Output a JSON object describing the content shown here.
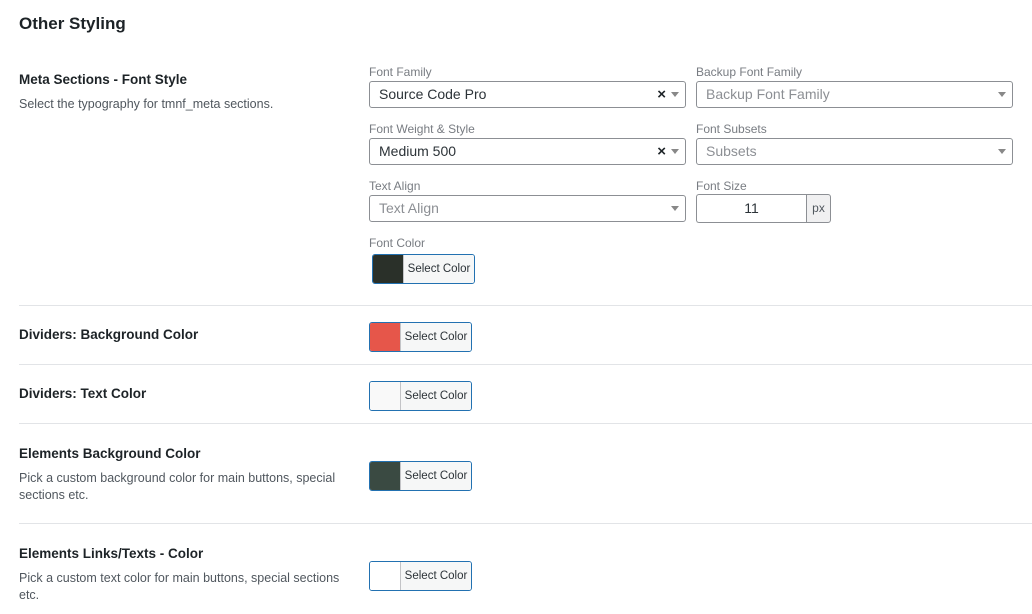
{
  "page": {
    "title": "Other Styling"
  },
  "meta_font": {
    "title": "Meta Sections - Font Style",
    "description": "Select the typography for tmnf_meta sections.",
    "font_family": {
      "label": "Font Family",
      "value": "Source Code Pro"
    },
    "backup_font_family": {
      "label": "Backup Font Family",
      "placeholder": "Backup Font Family"
    },
    "font_weight": {
      "label": "Font Weight & Style",
      "value": "Medium 500"
    },
    "font_subsets": {
      "label": "Font Subsets",
      "placeholder": "Subsets"
    },
    "text_align": {
      "label": "Text Align",
      "placeholder": "Text Align"
    },
    "font_size": {
      "label": "Font Size",
      "value": "11",
      "unit": "px"
    },
    "font_color": {
      "label": "Font Color",
      "button": "Select Color",
      "color": "#2a3029"
    }
  },
  "dividers_bg": {
    "title": "Dividers: Background Color",
    "button": "Select Color",
    "color": "#e6564a"
  },
  "dividers_text": {
    "title": "Dividers: Text Color",
    "button": "Select Color",
    "color": "#f9f9f9"
  },
  "elements_bg": {
    "title": "Elements Background Color",
    "description": "Pick a custom background color for main buttons, special sections etc.",
    "button": "Select Color",
    "color": "#3a4a42"
  },
  "elements_links": {
    "title": "Elements Links/Texts - Color",
    "description": "Pick a custom text color for main buttons, special sections etc.",
    "button": "Select Color",
    "color": "#ffffff"
  }
}
